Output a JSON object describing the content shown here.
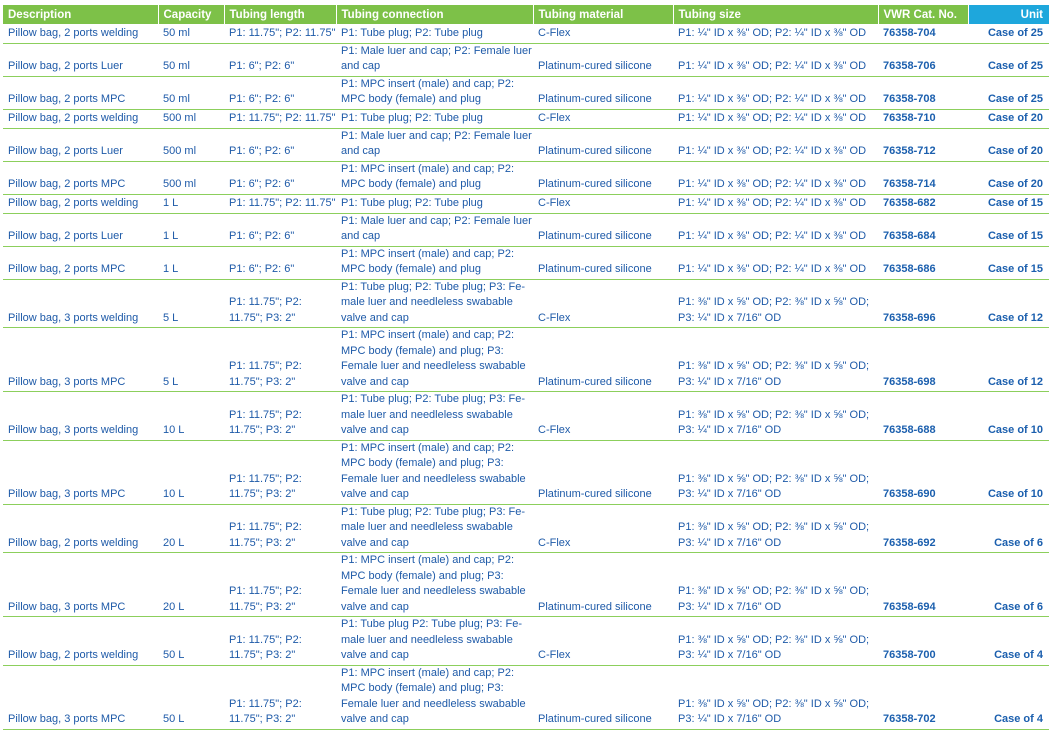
{
  "headers": [
    "Description",
    "Capacity",
    "Tubing length",
    "Tubing connection",
    "Tubing material",
    "Tubing size",
    "VWR Cat. No.",
    "Unit"
  ],
  "rows": [
    {
      "desc": "Pillow bag, 2 ports welding",
      "cap": "50 ml",
      "len": "P1: 11.75\"; P2: 11.75\"",
      "conn": "P1: Tube plug; P2: Tube plug",
      "mat": "C-Flex",
      "size": "P1: ¼\" ID x ⅜\" OD; P2: ¼\" ID x ⅜\" OD",
      "cat": "76358-704",
      "unit": "Case of 25"
    },
    {
      "desc": "Pillow bag, 2 ports Luer",
      "cap": "50 ml",
      "len": "P1: 6\"; P2: 6\"",
      "conn": "P1: Male luer and cap; P2: Female luer and cap",
      "mat": "Platinum-cured silicone",
      "size": "P1: ¼\" ID x ⅜\" OD; P2: ¼\" ID x ⅜\" OD",
      "cat": "76358-706",
      "unit": "Case of 25"
    },
    {
      "desc": "Pillow bag, 2 ports MPC",
      "cap": "50 ml",
      "len": "P1: 6\"; P2: 6\"",
      "conn": "P1: MPC insert (male) and cap; P2: MPC body (female) and plug",
      "mat": "Platinum-cured silicone",
      "size": "P1: ¼\" ID x ⅜\" OD; P2: ¼\" ID x ⅜\" OD",
      "cat": "76358-708",
      "unit": "Case of 25"
    },
    {
      "desc": "Pillow bag, 2 ports welding",
      "cap": "500 ml",
      "len": "P1: 11.75\"; P2: 11.75\"",
      "conn": "P1: Tube plug; P2: Tube plug",
      "mat": "C-Flex",
      "size": "P1: ¼\" ID x ⅜\" OD; P2: ¼\" ID x ⅜\" OD",
      "cat": "76358-710",
      "unit": "Case of 20"
    },
    {
      "desc": "Pillow bag, 2 ports Luer",
      "cap": "500 ml",
      "len": "P1: 6\"; P2: 6\"",
      "conn": "P1: Male luer and cap; P2: Female luer and cap",
      "mat": "Platinum-cured silicone",
      "size": "P1: ¼\" ID x ⅜\" OD; P2: ¼\" ID x ⅜\" OD",
      "cat": "76358-712",
      "unit": "Case of 20"
    },
    {
      "desc": "Pillow bag, 2 ports MPC",
      "cap": "500 ml",
      "len": "P1: 6\"; P2: 6\"",
      "conn": "P1: MPC insert (male) and cap; P2: MPC body (female) and plug",
      "mat": "Platinum-cured silicone",
      "size": "P1: ¼\" ID x ⅜\" OD; P2: ¼\" ID x ⅜\" OD",
      "cat": "76358-714",
      "unit": "Case of 20"
    },
    {
      "desc": "Pillow bag, 2 ports welding",
      "cap": "1 L",
      "len": "P1: 11.75\"; P2: 11.75\"",
      "conn": "P1: Tube plug; P2: Tube plug",
      "mat": "C-Flex",
      "size": "P1: ¼\" ID x ⅜\" OD; P2: ¼\" ID x ⅜\" OD",
      "cat": "76358-682",
      "unit": "Case of 15"
    },
    {
      "desc": "Pillow bag, 2 ports Luer",
      "cap": "1 L",
      "len": "P1: 6\"; P2: 6\"",
      "conn": "P1: Male luer and cap; P2: Female luer and cap",
      "mat": "Platinum-cured silicone",
      "size": "P1: ¼\" ID x ⅜\" OD; P2: ¼\" ID x ⅜\" OD",
      "cat": "76358-684",
      "unit": "Case of 15"
    },
    {
      "desc": "Pillow bag, 2 ports MPC",
      "cap": "1 L",
      "len": "P1: 6\"; P2: 6\"",
      "conn": "P1: MPC insert (male) and cap; P2: MPC body (female) and plug",
      "mat": "Platinum-cured silicone",
      "size": "P1: ¼\" ID x ⅜\" OD; P2: ¼\" ID x ⅜\" OD",
      "cat": "76358-686",
      "unit": "Case of 15"
    },
    {
      "desc": "Pillow bag, 3 ports welding",
      "cap": "5 L",
      "len": "P1: 11.75\"; P2: 11.75\"; P3: 2\"",
      "conn": "P1: Tube plug; P2: Tube plug; P3: Fe-male luer and needleless swabable valve and cap",
      "mat": "C-Flex",
      "size": "P1: ⅜\" ID x ⅝\" OD; P2: ⅜\" ID x ⅝\" OD; P3: ¼\" ID x 7/16\" OD",
      "cat": "76358-696",
      "unit": "Case of 12"
    },
    {
      "desc": "Pillow bag, 3 ports MPC",
      "cap": "5 L",
      "len": "P1: 11.75\"; P2: 11.75\"; P3: 2\"",
      "conn": "P1: MPC insert (male) and cap; P2: MPC body (female) and plug; P3: Female luer and needleless swabable valve and cap",
      "mat": "Platinum-cured silicone",
      "size": "P1: ⅜\" ID x ⅝\" OD; P2: ⅜\" ID x ⅝\" OD; P3: ¼\" ID x 7/16\" OD",
      "cat": "76358-698",
      "unit": "Case of 12"
    },
    {
      "desc": "Pillow bag, 3 ports welding",
      "cap": "10 L",
      "len": "P1: 11.75\"; P2: 11.75\"; P3: 2\"",
      "conn": "P1: Tube plug; P2: Tube plug; P3: Fe-male luer and needleless swabable valve and cap",
      "mat": "C-Flex",
      "size": "P1: ⅜\" ID x ⅝\" OD; P2: ⅜\" ID x ⅝\" OD; P3: ¼\" ID x 7/16\" OD",
      "cat": "76358-688",
      "unit": "Case of 10"
    },
    {
      "desc": "Pillow bag, 3 ports MPC",
      "cap": "10 L",
      "len": "P1: 11.75\"; P2: 11.75\"; P3: 2\"",
      "conn": "P1: MPC insert (male) and cap; P2: MPC body (female) and plug; P3: Female luer and needleless swabable valve and cap",
      "mat": "Platinum-cured silicone",
      "size": "P1: ⅜\" ID x ⅝\" OD; P2: ⅜\" ID x ⅝\" OD; P3: ¼\" ID x 7/16\" OD",
      "cat": "76358-690",
      "unit": "Case of 10"
    },
    {
      "desc": "Pillow bag, 2 ports welding",
      "cap": "20 L",
      "len": "P1: 11.75\"; P2: 11.75\"; P3: 2\"",
      "conn": "P1: Tube plug; P2: Tube plug; P3: Fe-male luer and needleless swabable valve and cap",
      "mat": "C-Flex",
      "size": "P1: ⅜\" ID x ⅝\" OD; P2: ⅜\" ID x ⅝\" OD; P3: ¼\" ID x 7/16\" OD",
      "cat": "76358-692",
      "unit": "Case of 6"
    },
    {
      "desc": "Pillow bag, 3 ports MPC",
      "cap": "20 L",
      "len": "P1: 11.75\"; P2: 11.75\"; P3: 2\"",
      "conn": "P1: MPC insert (male) and cap; P2: MPC body (female) and plug; P3: Female luer and needleless swabable valve and cap",
      "mat": "Platinum-cured silicone",
      "size": "P1: ⅜\" ID x ⅝\" OD; P2: ⅜\" ID x ⅝\" OD; P3: ¼\" ID x 7/16\" OD",
      "cat": "76358-694",
      "unit": "Case of 6"
    },
    {
      "desc": "Pillow bag, 2 ports welding",
      "cap": "50 L",
      "len": "P1: 11.75\"; P2: 11.75\"; P3: 2\"",
      "conn": "P1: Tube plug P2: Tube plug; P3: Fe-male luer and needleless swabable valve and cap",
      "mat": "C-Flex",
      "size": "P1: ⅜\" ID x ⅝\" OD; P2: ⅜\" ID x ⅝\" OD; P3: ¼\" ID x 7/16\" OD",
      "cat": "76358-700",
      "unit": "Case of 4"
    },
    {
      "desc": "Pillow bag, 3 ports MPC",
      "cap": "50 L",
      "len": "P1: 11.75\"; P2: 11.75\"; P3: 2\"",
      "conn": "P1: MPC insert (male) and cap; P2: MPC body (female) and plug; P3: Female luer and needleless swabable valve and cap",
      "mat": "Platinum-cured silicone",
      "size": "P1: ⅜\" ID x ⅝\" OD; P2: ⅜\" ID x ⅝\" OD; P3: ¼\" ID x 7/16\" OD",
      "cat": "76358-702",
      "unit": "Case of 4"
    }
  ]
}
